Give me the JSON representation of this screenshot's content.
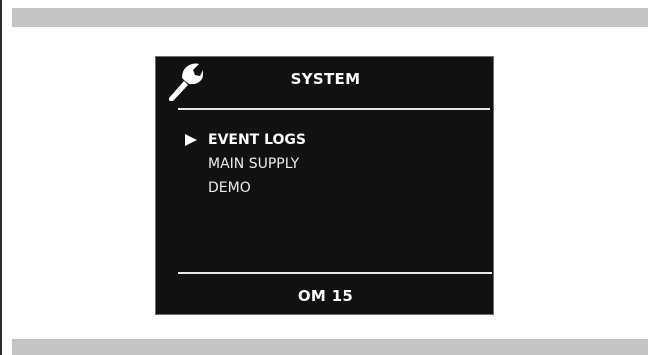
{
  "screen": {
    "title": "SYSTEM",
    "title_icon": "wrench-icon",
    "menu": [
      {
        "label": "EVENT LOGS",
        "selected": true
      },
      {
        "label": "MAIN SUPPLY",
        "selected": false
      },
      {
        "label": "DEMO",
        "selected": false
      }
    ],
    "cursor_icon": "right-triangle-icon",
    "footer": "OM 15"
  },
  "colors": {
    "screen_background": "#111111",
    "text": "#ffffff",
    "band": "#c4c4c4"
  }
}
